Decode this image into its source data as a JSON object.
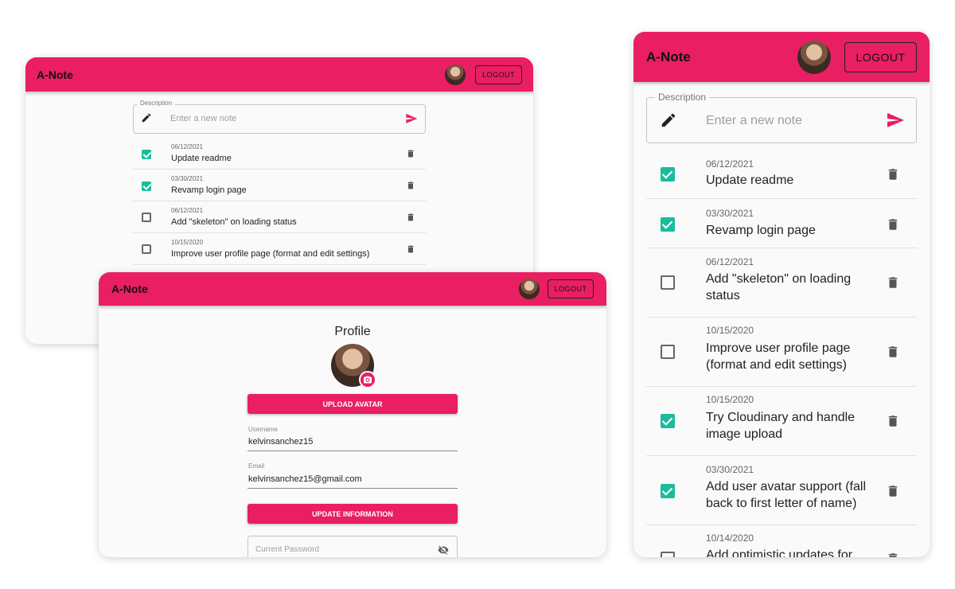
{
  "app": {
    "title": "A-Note",
    "logout_label": "LOGOUT",
    "accent": "#e91e63",
    "check_color": "#1abc9c"
  },
  "note_input": {
    "label": "Description",
    "placeholder": "Enter a new note"
  },
  "notes": [
    {
      "date": "06/12/2021",
      "text": "Update readme",
      "done": true
    },
    {
      "date": "03/30/2021",
      "text": "Revamp login page",
      "done": true
    },
    {
      "date": "06/12/2021",
      "text": "Add \"skeleton\" on loading status",
      "done": false
    },
    {
      "date": "10/15/2020",
      "text": "Improve user profile page (format and edit settings)",
      "done": false
    },
    {
      "date": "10/15/2020",
      "text": "Try Cloudinary and handle image upload",
      "done": true
    },
    {
      "date": "03/30/2021",
      "text": "Add user avatar support (fall back to first letter of name)",
      "done": true
    },
    {
      "date": "10/14/2020",
      "text": "Add optimistic updates for",
      "done": false
    }
  ],
  "profile": {
    "heading": "Profile",
    "upload_label": "UPLOAD AVATAR",
    "username_label": "Username",
    "username_value": "kelvinsanchez15",
    "email_label": "Email",
    "email_value": "kelvinsanchez15@gmail.com",
    "update_label": "UPDATE INFORMATION",
    "password_placeholder": "Current Password"
  }
}
